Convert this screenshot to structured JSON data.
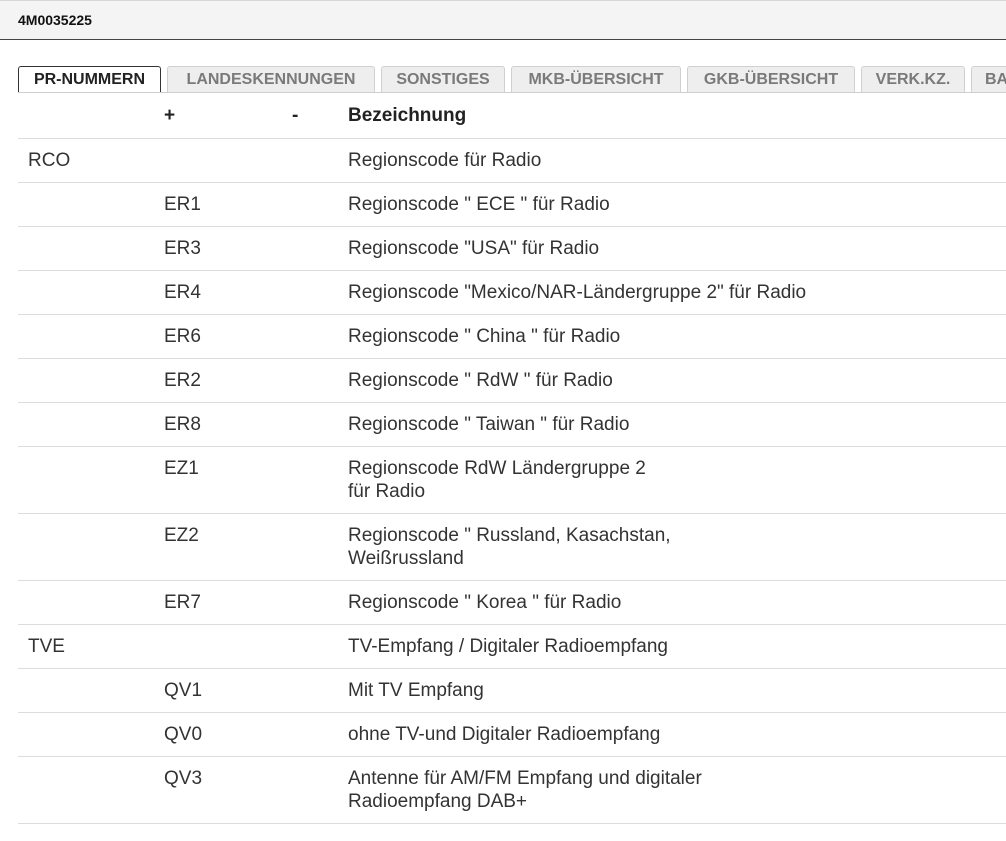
{
  "window": {
    "title": "4M0035225"
  },
  "tabs": [
    {
      "label": "PR-NUMMERN",
      "active": true
    },
    {
      "label": "LANDESKENNUNGEN",
      "active": false
    },
    {
      "label": "SONSTIGES",
      "active": false
    },
    {
      "label": "MKB-ÜBERSICHT",
      "active": false
    },
    {
      "label": "GKB-ÜBERSICHT",
      "active": false
    },
    {
      "label": "VERK.KZ.",
      "active": false
    },
    {
      "label": "BA",
      "active": false
    }
  ],
  "table": {
    "headers": {
      "code": "",
      "plus": "+",
      "minus": "-",
      "description": "Bezeichnung"
    },
    "rows": [
      {
        "code": "RCO",
        "plus": "",
        "minus": "",
        "desc1": "Regionscode für Radio",
        "desc2": ""
      },
      {
        "code": "",
        "plus": "ER1",
        "minus": "",
        "desc1": "Regionscode \" ECE \" für Radio",
        "desc2": ""
      },
      {
        "code": "",
        "plus": "ER3",
        "minus": "",
        "desc1": "Regionscode \"USA\" für Radio",
        "desc2": ""
      },
      {
        "code": "",
        "plus": "ER4",
        "minus": "",
        "desc1": "Regionscode \"Mexico/NAR-Ländergruppe 2\" für Radio",
        "desc2": ""
      },
      {
        "code": "",
        "plus": "ER6",
        "minus": "",
        "desc1": "Regionscode \" China \" für Radio",
        "desc2": ""
      },
      {
        "code": "",
        "plus": "ER2",
        "minus": "",
        "desc1": "Regionscode \" RdW \" für Radio",
        "desc2": ""
      },
      {
        "code": "",
        "plus": "ER8",
        "minus": "",
        "desc1": "Regionscode \" Taiwan \" für Radio",
        "desc2": ""
      },
      {
        "code": "",
        "plus": "EZ1",
        "minus": "",
        "desc1": "Regionscode RdW Ländergruppe 2",
        "desc2": "für Radio"
      },
      {
        "code": "",
        "plus": "EZ2",
        "minus": "",
        "desc1": "Regionscode \" Russland, Kasachstan,",
        "desc2": "Weißrussland"
      },
      {
        "code": "",
        "plus": "ER7",
        "minus": "",
        "desc1": "Regionscode \" Korea \" für Radio",
        "desc2": ""
      },
      {
        "code": "TVE",
        "plus": "",
        "minus": "",
        "desc1": "TV-Empfang / Digitaler Radioempfang",
        "desc2": ""
      },
      {
        "code": "",
        "plus": "QV1",
        "minus": "",
        "desc1": "Mit TV Empfang",
        "desc2": ""
      },
      {
        "code": "",
        "plus": "QV0",
        "minus": "",
        "desc1": "ohne TV-und Digitaler Radioempfang",
        "desc2": ""
      },
      {
        "code": "",
        "plus": "QV3",
        "minus": "",
        "desc1": "Antenne für AM/FM Empfang und digitaler",
        "desc2": "Radioempfang DAB+"
      }
    ]
  }
}
